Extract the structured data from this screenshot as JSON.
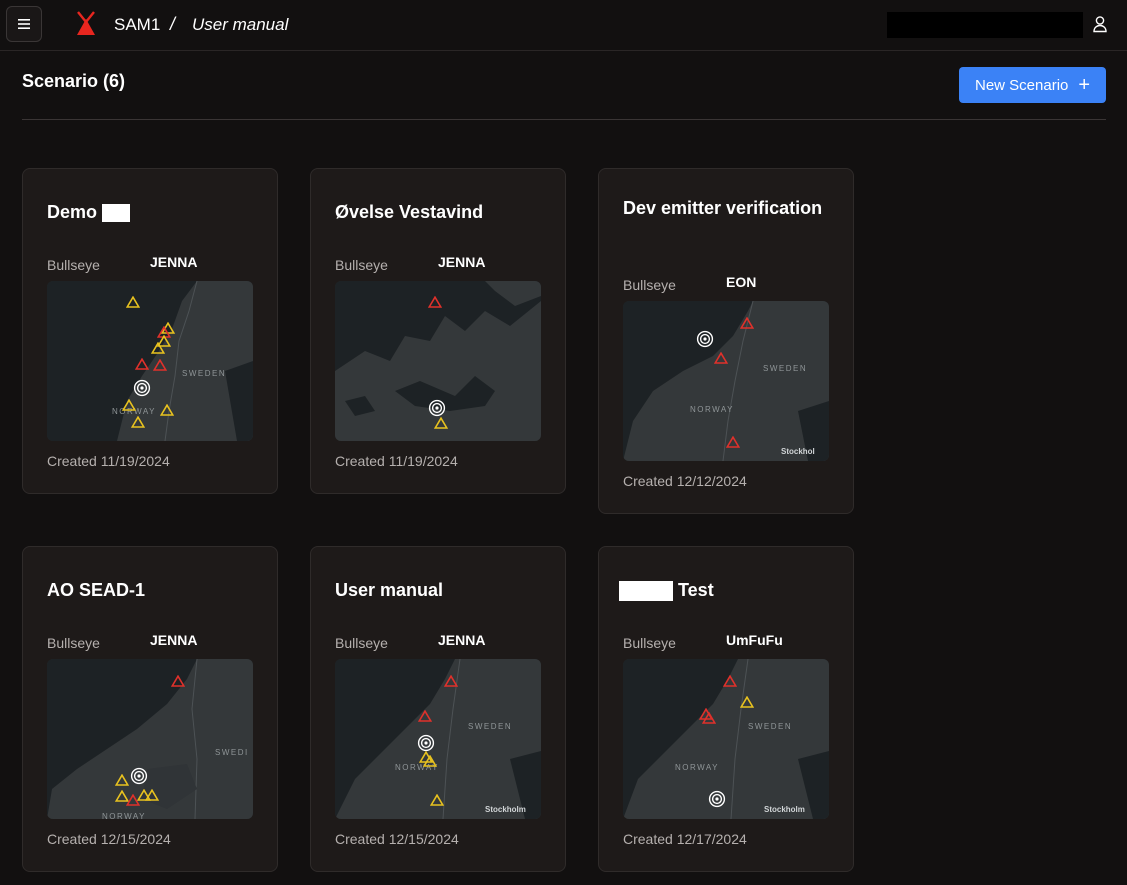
{
  "header": {
    "app_name": "SAM1",
    "separator": "/",
    "breadcrumb": "User manual"
  },
  "page": {
    "title": "Scenario (6)",
    "new_button_label": "New Scenario",
    "new_button_icon": "+"
  },
  "map_labels": {
    "sweden": "SWEDEN",
    "norway": "NORWAY",
    "stockholm": "Stockholm",
    "stockhol": "Stockhol",
    "swede": "SWEDI"
  },
  "scenarios": [
    {
      "title": "Demo",
      "bullseye_label": "Bullseye",
      "bullseye": "JENNA",
      "created": "Created 11/19/2024"
    },
    {
      "title": "Øvelse Vestavind",
      "bullseye_label": "Bullseye",
      "bullseye": "JENNA",
      "created": "Created 11/19/2024"
    },
    {
      "title": "Dev emitter verification",
      "bullseye_label": "Bullseye",
      "bullseye": "EON",
      "created": "Created 12/12/2024"
    },
    {
      "title": "AO SEAD-1",
      "bullseye_label": "Bullseye",
      "bullseye": "JENNA",
      "created": "Created 12/15/2024"
    },
    {
      "title": "User manual",
      "bullseye_label": "Bullseye",
      "bullseye": "JENNA",
      "created": "Created 12/15/2024"
    },
    {
      "title": "Test",
      "bullseye_label": "Bullseye",
      "bullseye": "UmFuFu",
      "created": "Created 12/17/2024"
    }
  ],
  "colors": {
    "background": "#121010",
    "card": "#1e1a19",
    "accent_blue": "#3b82f6",
    "threat_red": "#e0312b",
    "threat_yellow": "#e8c21f",
    "logo_red": "#e8261f"
  }
}
